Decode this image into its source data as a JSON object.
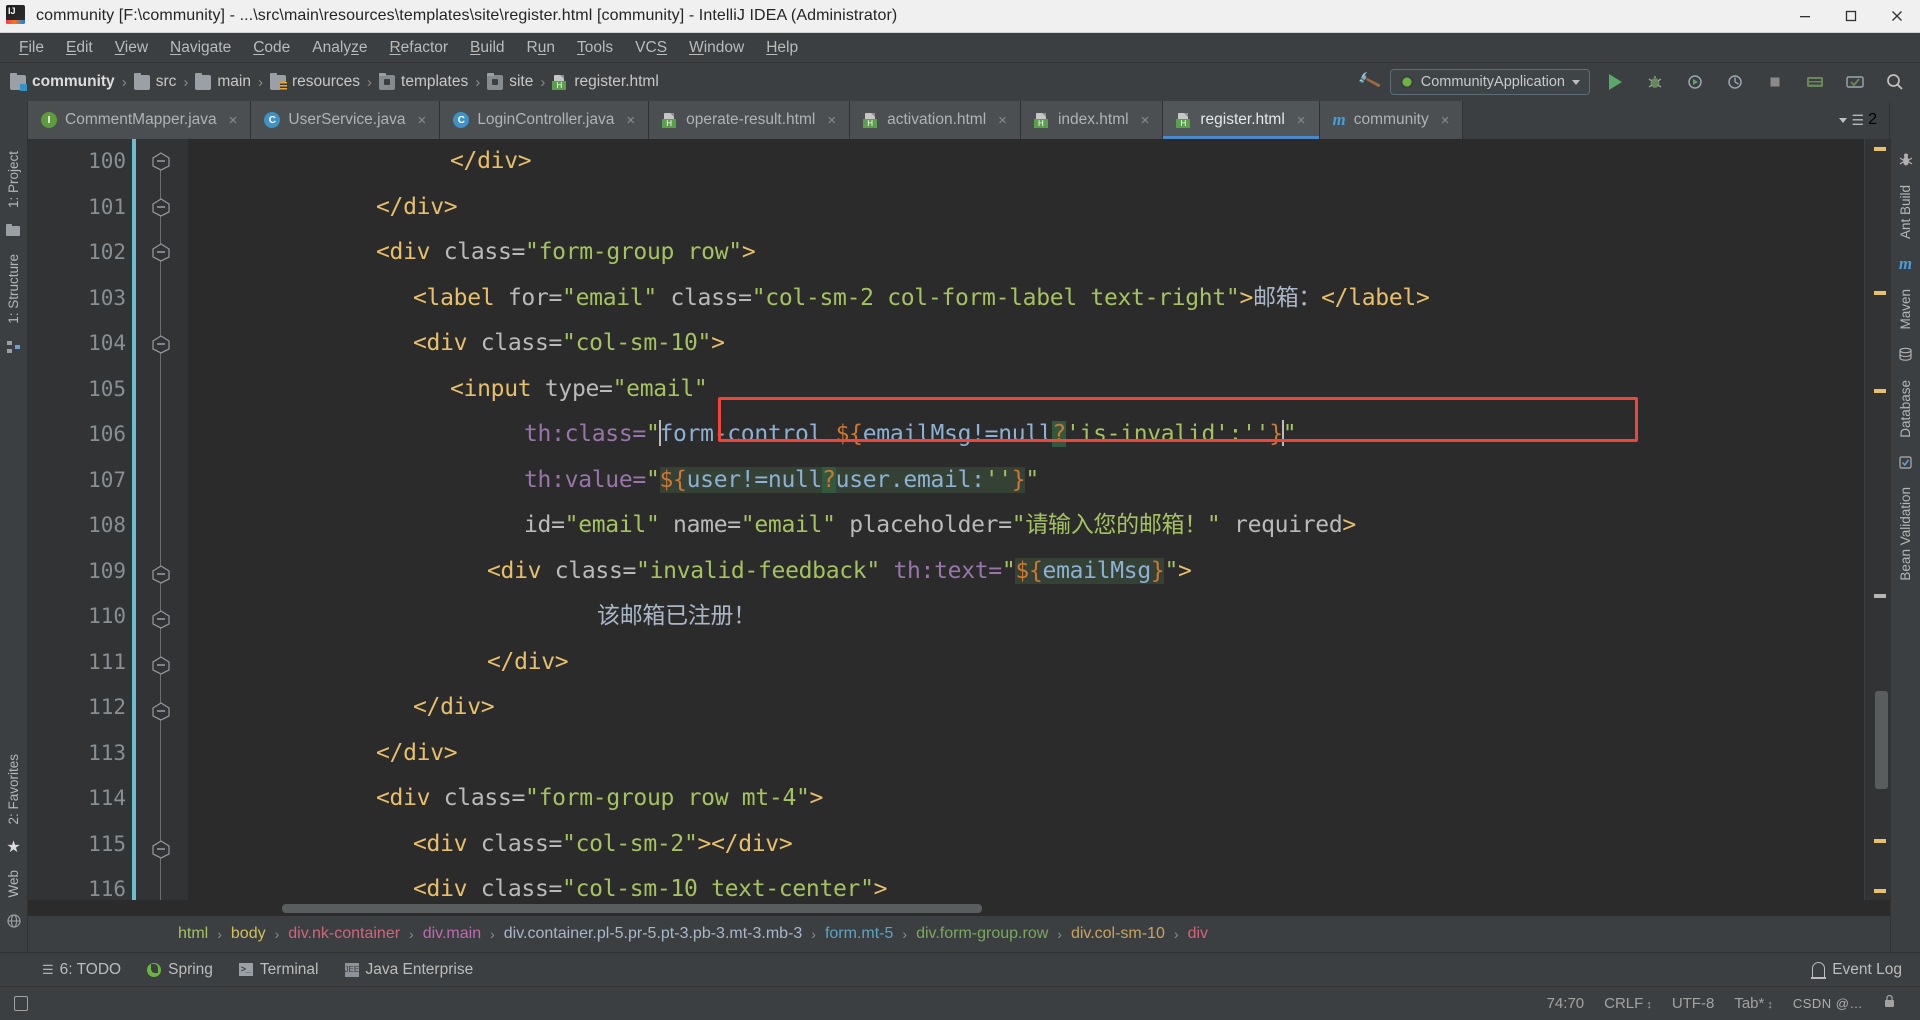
{
  "window": {
    "title": "community [F:\\community] - ...\\src\\main\\resources\\templates\\site\\register.html [community] - IntelliJ IDEA (Administrator)",
    "app_icon": "intellij-idea-icon",
    "minimize_label": "Minimize",
    "maximize_label": "Maximize",
    "close_label": "Close"
  },
  "menubar": {
    "items": [
      {
        "label": "File",
        "mnemonic": "F"
      },
      {
        "label": "Edit",
        "mnemonic": "E"
      },
      {
        "label": "View",
        "mnemonic": "V"
      },
      {
        "label": "Navigate",
        "mnemonic": "N"
      },
      {
        "label": "Code",
        "mnemonic": "C"
      },
      {
        "label": "Analyze",
        "mnemonic": "z"
      },
      {
        "label": "Refactor",
        "mnemonic": "R"
      },
      {
        "label": "Build",
        "mnemonic": "B"
      },
      {
        "label": "Run",
        "mnemonic": "u"
      },
      {
        "label": "Tools",
        "mnemonic": "T"
      },
      {
        "label": "VCS",
        "mnemonic": "S"
      },
      {
        "label": "Window",
        "mnemonic": "W"
      },
      {
        "label": "Help",
        "mnemonic": "H"
      }
    ]
  },
  "navbar": {
    "breadcrumbs": [
      {
        "label": "community",
        "icon": "module-icon"
      },
      {
        "label": "src",
        "icon": "folder-icon"
      },
      {
        "label": "main",
        "icon": "folder-icon"
      },
      {
        "label": "resources",
        "icon": "resources-folder-icon"
      },
      {
        "label": "templates",
        "icon": "folder-dark-icon"
      },
      {
        "label": "site",
        "icon": "folder-dark-icon"
      },
      {
        "label": "register.html",
        "icon": "html-file-icon"
      }
    ],
    "build_icon": "hammer-icon",
    "run_config": "CommunityApplication",
    "run_config_icon": "spring-boot-icon",
    "actions": [
      {
        "name": "run-button",
        "icon": "play-icon"
      },
      {
        "name": "debug-button",
        "icon": "bug-icon"
      },
      {
        "name": "run-with-coverage-button",
        "icon": "coverage-icon"
      },
      {
        "name": "profile-button",
        "icon": "profiler-icon"
      },
      {
        "name": "stop-button",
        "icon": "stop-icon"
      },
      {
        "name": "update-project-button",
        "icon": "update-icon"
      },
      {
        "name": "commit-button",
        "icon": "commit-icon"
      },
      {
        "name": "search-everywhere-button",
        "icon": "search-icon"
      }
    ]
  },
  "editor_tabs": {
    "tabs": [
      {
        "label": "CommentMapper.java",
        "icon": "java-interface-icon",
        "icon_letter": "I",
        "active": false
      },
      {
        "label": "UserService.java",
        "icon": "java-class-icon",
        "icon_letter": "C",
        "active": false
      },
      {
        "label": "LoginController.java",
        "icon": "java-class-icon",
        "icon_letter": "C",
        "active": false
      },
      {
        "label": "operate-result.html",
        "icon": "html-file-icon",
        "icon_letter": "H",
        "active": false
      },
      {
        "label": "activation.html",
        "icon": "html-file-icon",
        "icon_letter": "H",
        "active": false
      },
      {
        "label": "index.html",
        "icon": "html-file-icon",
        "icon_letter": "H",
        "active": false
      },
      {
        "label": "register.html",
        "icon": "html-file-icon",
        "icon_letter": "H",
        "active": true
      },
      {
        "label": "community",
        "icon": "maven-icon",
        "icon_letter": "m",
        "active": false
      }
    ],
    "hidden_tabs_count": "2",
    "close_label": "×"
  },
  "left_strip": {
    "items": [
      {
        "label": "1: Project",
        "icon": "project-icon"
      },
      {
        "label": "1: Structure",
        "icon": "structure-icon"
      },
      {
        "label": "2: Favorites",
        "icon": "favorites-star-icon"
      },
      {
        "label": "Web",
        "icon": "web-icon"
      }
    ]
  },
  "right_strip": {
    "items": [
      {
        "label": "Ant Build",
        "icon": "ant-icon"
      },
      {
        "label": "Maven",
        "icon": "maven-icon"
      },
      {
        "label": "Database",
        "icon": "database-icon"
      },
      {
        "label": "Bean Validation",
        "icon": "bean-validation-icon"
      }
    ]
  },
  "editor": {
    "first_line_number": 100,
    "line_numbers": [
      "100",
      "101",
      "102",
      "103",
      "104",
      "105",
      "106",
      "107",
      "108",
      "109",
      "110",
      "111",
      "112",
      "113",
      "114",
      "115",
      "116"
    ],
    "lines": [
      {
        "n": "100",
        "indent": 16,
        "tokens": [
          {
            "t": "tag",
            "v": "</div>"
          }
        ]
      },
      {
        "n": "101",
        "indent": 12,
        "tokens": [
          {
            "t": "tag",
            "v": "</div>"
          }
        ]
      },
      {
        "n": "102",
        "indent": 12,
        "tokens": [
          {
            "t": "tag",
            "v": "<div "
          },
          {
            "t": "attr",
            "v": "class="
          },
          {
            "t": "val",
            "v": "\"form-group row\""
          },
          {
            "t": "tag",
            "v": ">"
          }
        ]
      },
      {
        "n": "103",
        "indent": 16,
        "tokens": [
          {
            "t": "tag",
            "v": "<label "
          },
          {
            "t": "attr",
            "v": "for="
          },
          {
            "t": "val",
            "v": "\"email\""
          },
          {
            "t": "attr",
            "v": " class="
          },
          {
            "t": "val",
            "v": "\"col-sm-2 col-form-label text-right\""
          },
          {
            "t": "tag",
            "v": ">"
          },
          {
            "t": "txt",
            "v": "邮箱："
          },
          {
            "t": "tag",
            "v": "</label>"
          }
        ]
      },
      {
        "n": "104",
        "indent": 16,
        "tokens": [
          {
            "t": "tag",
            "v": "<div "
          },
          {
            "t": "attr",
            "v": "class="
          },
          {
            "t": "val",
            "v": "\"col-sm-10\""
          },
          {
            "t": "tag",
            "v": ">"
          }
        ]
      },
      {
        "n": "105",
        "indent": 20,
        "tokens": [
          {
            "t": "tag",
            "v": "<input "
          },
          {
            "t": "attr",
            "v": "type="
          },
          {
            "t": "val",
            "v": "\"email\""
          }
        ]
      },
      {
        "n": "106",
        "indent": 26,
        "highlighted": true,
        "tokens": [
          {
            "t": "attrth",
            "v": "th:class="
          },
          {
            "t": "q",
            "v": "\""
          },
          {
            "t": "el",
            "v": "form-control "
          },
          {
            "t": "dollar",
            "v": "${"
          },
          {
            "t": "el",
            "v": "emailMsg!=null"
          },
          {
            "t": "dollar",
            "v": "?"
          },
          {
            "t": "val",
            "v": "'is-invalid':''"
          },
          {
            "t": "dollar",
            "v": "}"
          },
          {
            "t": "q",
            "v": "\""
          }
        ]
      },
      {
        "n": "107",
        "indent": 26,
        "tokens": [
          {
            "t": "attrth",
            "v": "th:value="
          },
          {
            "t": "q",
            "v": "\""
          },
          {
            "t": "dollar",
            "v": "${"
          },
          {
            "t": "el",
            "v": "user!=null"
          },
          {
            "t": "dollar",
            "v": "?"
          },
          {
            "t": "el",
            "v": "user.email:"
          },
          {
            "t": "val",
            "v": "''"
          },
          {
            "t": "dollar",
            "v": "}"
          },
          {
            "t": "q",
            "v": "\""
          }
        ]
      },
      {
        "n": "108",
        "indent": 26,
        "tokens": [
          {
            "t": "attr",
            "v": "id="
          },
          {
            "t": "val",
            "v": "\"email\""
          },
          {
            "t": "attr",
            "v": " name="
          },
          {
            "t": "val",
            "v": "\"email\""
          },
          {
            "t": "attr",
            "v": " placeholder="
          },
          {
            "t": "val",
            "v": "\"请输入您的邮箱！\""
          },
          {
            "t": "attr",
            "v": " required"
          },
          {
            "t": "tag",
            "v": ">"
          }
        ]
      },
      {
        "n": "109",
        "indent": 20,
        "tokens": [
          {
            "t": "tag",
            "v": "<div "
          },
          {
            "t": "attr",
            "v": "class="
          },
          {
            "t": "val",
            "v": "\"invalid-feedback\""
          },
          {
            "t": "attrth",
            "v": " th:text="
          },
          {
            "t": "q",
            "v": "\""
          },
          {
            "t": "dollar",
            "v": "${"
          },
          {
            "t": "el",
            "v": "emailMsg"
          },
          {
            "t": "dollar",
            "v": "}"
          },
          {
            "t": "q",
            "v": "\""
          },
          {
            "t": "tag",
            "v": ">"
          }
        ]
      },
      {
        "n": "110",
        "indent": 24,
        "tokens": [
          {
            "t": "txt",
            "v": "该邮箱已注册！"
          }
        ]
      },
      {
        "n": "111",
        "indent": 20,
        "tokens": [
          {
            "t": "tag",
            "v": "</div>"
          }
        ]
      },
      {
        "n": "112",
        "indent": 16,
        "tokens": [
          {
            "t": "tag",
            "v": "</div>"
          }
        ]
      },
      {
        "n": "113",
        "indent": 12,
        "tokens": [
          {
            "t": "tag",
            "v": "</div>"
          }
        ]
      },
      {
        "n": "114",
        "indent": 12,
        "tokens": [
          {
            "t": "tag",
            "v": "<div "
          },
          {
            "t": "attr",
            "v": "class="
          },
          {
            "t": "val",
            "v": "\"form-group row mt-4\""
          },
          {
            "t": "tag",
            "v": ">"
          }
        ]
      },
      {
        "n": "115",
        "indent": 16,
        "tokens": [
          {
            "t": "tag",
            "v": "<div "
          },
          {
            "t": "attr",
            "v": "class="
          },
          {
            "t": "val",
            "v": "\"col-sm-2\""
          },
          {
            "t": "tag",
            "v": ">"
          },
          {
            "t": "tag",
            "v": "</div>"
          }
        ]
      },
      {
        "n": "116",
        "indent": 16,
        "tokens": [
          {
            "t": "tag",
            "v": "<div "
          },
          {
            "t": "attr",
            "v": "class="
          },
          {
            "t": "val",
            "v": "\"col-sm-10 text-center\""
          },
          {
            "t": "tag",
            "v": ">"
          }
        ]
      }
    ],
    "annotation": {
      "type": "red-rectangle",
      "target_line": "106"
    }
  },
  "bottom_breadcrumb": {
    "segments": [
      {
        "label": "html",
        "color": "#a5c261"
      },
      {
        "label": "body",
        "color": "#d0c05a"
      },
      {
        "label": "div.nk-container",
        "color": "#d0657a"
      },
      {
        "label": "div.main",
        "color": "#c06ab0"
      },
      {
        "label": "div.container.pl-5.pr-5.pt-3.pb-3.mt-3.mb-3",
        "color": "#a9b7c6"
      },
      {
        "label": "form.mt-5",
        "color": "#5ba3c4"
      },
      {
        "label": "div.form-group.row",
        "color": "#7aa85c"
      },
      {
        "label": "div.col-sm-10",
        "color": "#c9a45c"
      },
      {
        "label": "div",
        "color": "#d0657a"
      }
    ],
    "separator": "›"
  },
  "bottom_toolwindows": {
    "items": [
      {
        "label": "6: TODO",
        "mnemonic": "6",
        "icon": "todo-icon"
      },
      {
        "label": "Spring",
        "icon": "spring-icon"
      },
      {
        "label": "Terminal",
        "icon": "terminal-icon"
      },
      {
        "label": "Java Enterprise",
        "icon": "java-enterprise-icon"
      }
    ],
    "event_log": "Event Log",
    "event_log_icon": "bell-icon"
  },
  "statusbar": {
    "hide_icon": "hide-toolwindows-icon",
    "caret_position": "74:70",
    "line_separator": "CRLF",
    "encoding": "UTF-8",
    "indent": "Tab*",
    "watermark": "CSDN @…",
    "lock_icon": "lock-icon"
  },
  "colors": {
    "accent": "#4a88c7",
    "annotation_red": "#f0453a",
    "editor_bg": "#2b2b2b",
    "chrome_bg": "#3c3f41",
    "gutter_bg": "#313335",
    "tag": "#e8bf6a",
    "attr_value": "#a5c261",
    "el_expr": "#8cb1d4",
    "thymeleaf_attr": "#9876aa",
    "dollar": "#cc7832"
  }
}
